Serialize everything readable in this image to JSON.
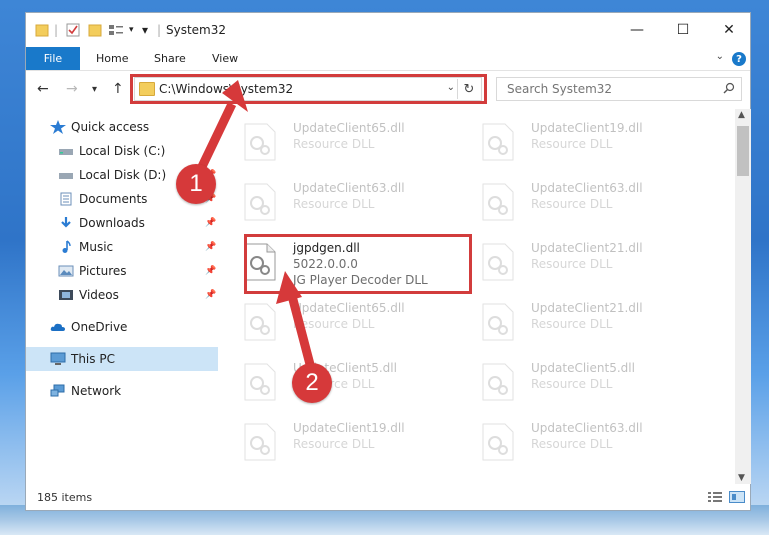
{
  "window": {
    "title": "System32",
    "controls": {
      "minimize": "—",
      "maximize": "☐",
      "close": "✕"
    }
  },
  "ribbon": {
    "tabs": [
      {
        "label": "File"
      },
      {
        "label": "Home"
      },
      {
        "label": "Share"
      },
      {
        "label": "View"
      }
    ],
    "help": "?"
  },
  "address": {
    "path": "C:\\Windows\\System32",
    "search_placeholder": "Search System32"
  },
  "navpane": {
    "items": [
      {
        "label": "Quick access",
        "icon": "star-icon",
        "pinned": false
      },
      {
        "label": "Local Disk (C:)",
        "icon": "drive-icon",
        "pinned": false
      },
      {
        "label": "Local Disk (D:)",
        "icon": "drive-icon",
        "pinned": true
      },
      {
        "label": "Documents",
        "icon": "documents-icon",
        "pinned": true
      },
      {
        "label": "Downloads",
        "icon": "downloads-icon",
        "pinned": true
      },
      {
        "label": "Music",
        "icon": "music-icon",
        "pinned": true
      },
      {
        "label": "Pictures",
        "icon": "pictures-icon",
        "pinned": true
      },
      {
        "label": "Videos",
        "icon": "videos-icon",
        "pinned": true
      },
      {
        "label": "OneDrive",
        "icon": "onedrive-icon",
        "pinned": false
      },
      {
        "label": "This PC",
        "icon": "computer-icon",
        "pinned": false,
        "selected": true
      },
      {
        "label": "Network",
        "icon": "network-icon",
        "pinned": false
      }
    ]
  },
  "files": {
    "left": [
      {
        "name": "UpdateClient65.dll",
        "type": "Resource DLL",
        "faded": true
      },
      {
        "name": "UpdateClient63.dll",
        "type": "Resource DLL",
        "faded": true
      },
      {
        "name": "jgpdgen.dll",
        "version": "5022.0.0.0",
        "type": "JG Player Decoder DLL",
        "faded": false
      },
      {
        "name": "UpdateClient65.dll",
        "type": "Resource DLL",
        "faded": true
      },
      {
        "name": "UpdateClient5.dll",
        "type": "Resource DLL",
        "faded": true
      },
      {
        "name": "UpdateClient19.dll",
        "type": "Resource DLL",
        "faded": true
      }
    ],
    "right": [
      {
        "name": "UpdateClient19.dll",
        "type": "Resource DLL",
        "faded": true
      },
      {
        "name": "UpdateClient63.dll",
        "type": "Resource DLL",
        "faded": true
      },
      {
        "name": "UpdateClient21.dll",
        "type": "Resource DLL",
        "faded": true
      },
      {
        "name": "UpdateClient21.dll",
        "type": "Resource DLL",
        "faded": true
      },
      {
        "name": "UpdateClient5.dll",
        "type": "Resource DLL",
        "faded": true
      },
      {
        "name": "UpdateClient63.dll",
        "type": "Resource DLL",
        "faded": true
      }
    ]
  },
  "status": {
    "item_count": "185 items"
  },
  "annotations": {
    "badge1": "1",
    "badge2": "2",
    "color": "#d6393a"
  }
}
